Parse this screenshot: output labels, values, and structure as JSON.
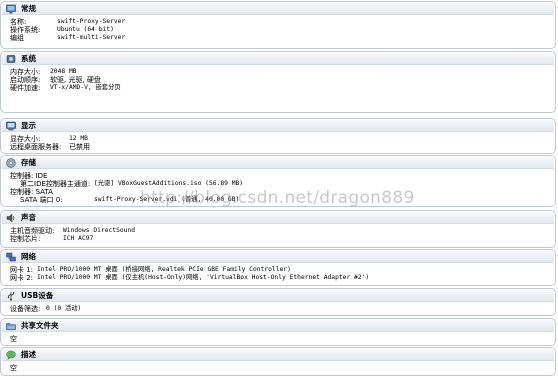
{
  "sections": {
    "general": {
      "title": "常规",
      "rows": [
        {
          "label": "名称:",
          "value": "swift-Proxy-Server"
        },
        {
          "label": "操作系统:",
          "value": "Ubuntu (64 bit)"
        },
        {
          "label": "编组",
          "value": "swift-multi-Server"
        }
      ]
    },
    "system": {
      "title": "系统",
      "rows": [
        {
          "label": "内存大小:",
          "value": "2048 MB"
        },
        {
          "label": "启动顺序:",
          "value": "软驱, 光驱, 硬盘"
        },
        {
          "label": "硬件加速:",
          "value": "VT-x/AMD-V, 嵌套分页"
        }
      ]
    },
    "display": {
      "title": "显示",
      "rows": [
        {
          "label": "显存大小:",
          "value": "12 MB"
        },
        {
          "label": "远程桌面服务器:",
          "value": "已禁用"
        }
      ]
    },
    "storage": {
      "title": "存储",
      "rows": [
        {
          "label": "控制器: IDE",
          "value": ""
        },
        {
          "label": "第二IDE控制器主通道:",
          "value": "[光驱] VBoxGuestAdditions.iso (56.89 MB)"
        },
        {
          "label": "控制器: SATA",
          "value": ""
        },
        {
          "label": "SATA 端口 0:",
          "value": "swift-Proxy-Server.vdi (普通, 40.00 GB)"
        }
      ]
    },
    "audio": {
      "title": "声音",
      "rows": [
        {
          "label": "主机音频驱动:",
          "value": "Windows DirectSound"
        },
        {
          "label": "控制芯片:",
          "value": "ICH AC97"
        }
      ]
    },
    "network": {
      "title": "网络",
      "rows": [
        {
          "label": "网卡 1:",
          "value": "Intel PRO/1000 MT 桌面 (桥接网络, Realtek PCIe GBE Family Controller)"
        },
        {
          "label": "网卡 2:",
          "value": "Intel PRO/1000 MT 桌面 (仅主机(Host-Only)网络, 'VirtualBox Host-Only Ethernet Adapter #2')"
        }
      ]
    },
    "usb": {
      "title": "USB设备",
      "rows": [
        {
          "label": "设备筛选:",
          "value": "0 (0 活动)"
        }
      ]
    },
    "shared": {
      "title": "共享文件夹",
      "rows": [
        {
          "label": "空",
          "value": ""
        }
      ]
    },
    "description": {
      "title": "描述",
      "rows": [
        {
          "label": "空",
          "value": ""
        }
      ]
    }
  },
  "watermark": "http://blog.csdn.net/dragon889",
  "icons": {
    "general": "monitor-icon",
    "system": "chip-icon",
    "display": "display-icon",
    "storage": "disk-icon",
    "audio": "speaker-icon",
    "network": "network-icon",
    "usb": "usb-icon",
    "shared": "folder-icon",
    "description": "speech-bubble-icon"
  }
}
